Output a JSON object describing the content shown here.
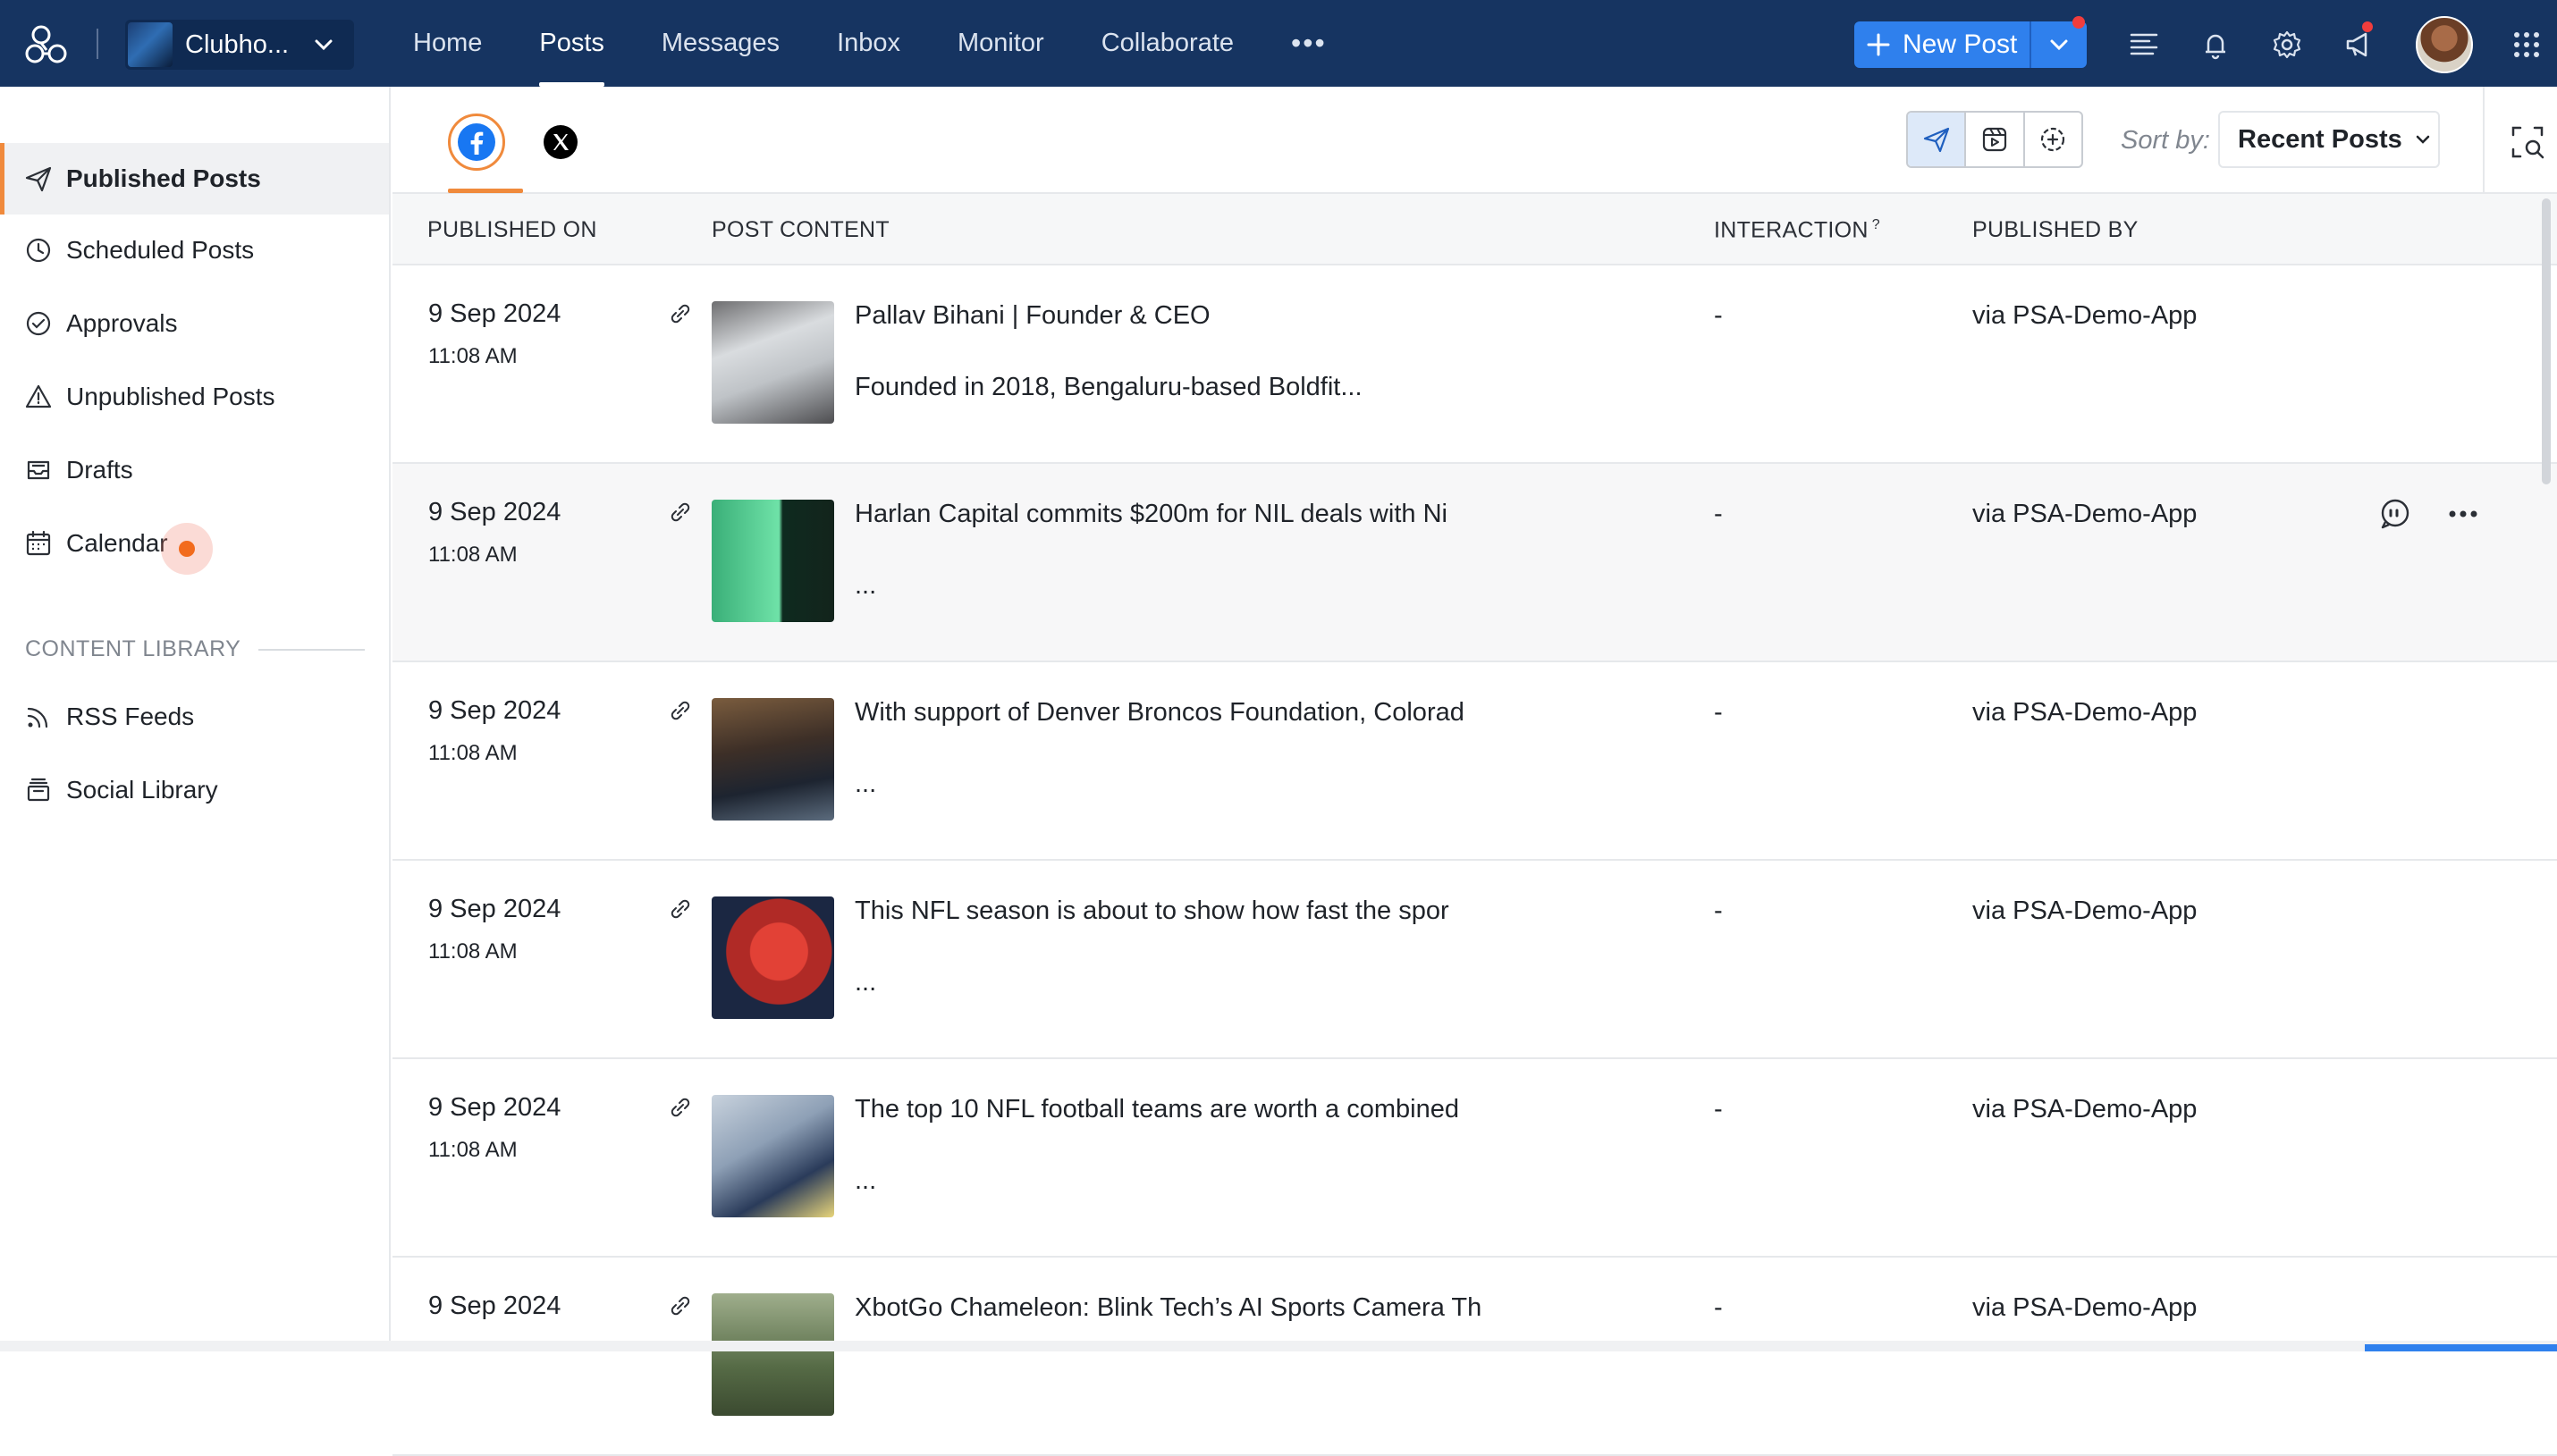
{
  "topbar": {
    "brand_name": "Clubho...",
    "nav": [
      {
        "label": "Home"
      },
      {
        "label": "Posts"
      },
      {
        "label": "Messages"
      },
      {
        "label": "Inbox"
      },
      {
        "label": "Monitor"
      },
      {
        "label": "Collaborate"
      }
    ],
    "more_label": "•••",
    "new_post_label": "New Post"
  },
  "sidebar": {
    "items": [
      {
        "label": "Published Posts",
        "icon": "send-icon"
      },
      {
        "label": "Scheduled Posts",
        "icon": "clock-icon"
      },
      {
        "label": "Approvals",
        "icon": "check-circle-icon"
      },
      {
        "label": "Unpublished Posts",
        "icon": "warning-icon"
      },
      {
        "label": "Drafts",
        "icon": "inbox-tray-icon"
      },
      {
        "label": "Calendar",
        "icon": "calendar-icon"
      }
    ],
    "section_title": "CONTENT LIBRARY",
    "library_items": [
      {
        "label": "RSS Feeds",
        "icon": "rss-icon"
      },
      {
        "label": "Social Library",
        "icon": "library-icon"
      }
    ]
  },
  "toolbar": {
    "sort_label": "Sort by:",
    "sort_value": "Recent Posts"
  },
  "table": {
    "headers": {
      "published_on": "PUBLISHED ON",
      "post_content": "POST CONTENT",
      "interaction": "INTERACTION",
      "interaction_sup": "?",
      "published_by": "PUBLISHED BY"
    },
    "rows": [
      {
        "date": "9 Sep 2024",
        "time": "11:08 AM",
        "title": "Pallav Bihani | Founder & CEO",
        "body": "Founded in 2018, Bengaluru-based Boldfit...",
        "interaction": "-",
        "published_by": "via PSA-Demo-App"
      },
      {
        "date": "9 Sep 2024",
        "time": "11:08 AM",
        "title": "Harlan Capital commits $200m for NIL deals with Ni",
        "body": "...",
        "interaction": "-",
        "published_by": "via PSA-Demo-App"
      },
      {
        "date": "9 Sep 2024",
        "time": "11:08 AM",
        "title": "With support of Denver Broncos Foundation, Colorad",
        "body": "...",
        "interaction": "-",
        "published_by": "via PSA-Demo-App"
      },
      {
        "date": "9 Sep 2024",
        "time": "11:08 AM",
        "title": "This NFL season is about to show how fast the spor",
        "body": "...",
        "interaction": "-",
        "published_by": "via PSA-Demo-App"
      },
      {
        "date": "9 Sep 2024",
        "time": "11:08 AM",
        "title": "The top 10 NFL football teams are worth a combined",
        "body": "...",
        "interaction": "-",
        "published_by": "via PSA-Demo-App"
      },
      {
        "date": "9 Sep 2024",
        "time": "",
        "title": "XbotGo Chameleon: Blink Tech’s AI Sports Camera Th",
        "body": "",
        "interaction": "-",
        "published_by": "via PSA-Demo-App"
      }
    ]
  },
  "colors": {
    "topbar_bg": "#163461",
    "accent_orange": "#f08a3c",
    "primary_blue": "#2f80ed",
    "facebook_blue": "#1877f2"
  }
}
